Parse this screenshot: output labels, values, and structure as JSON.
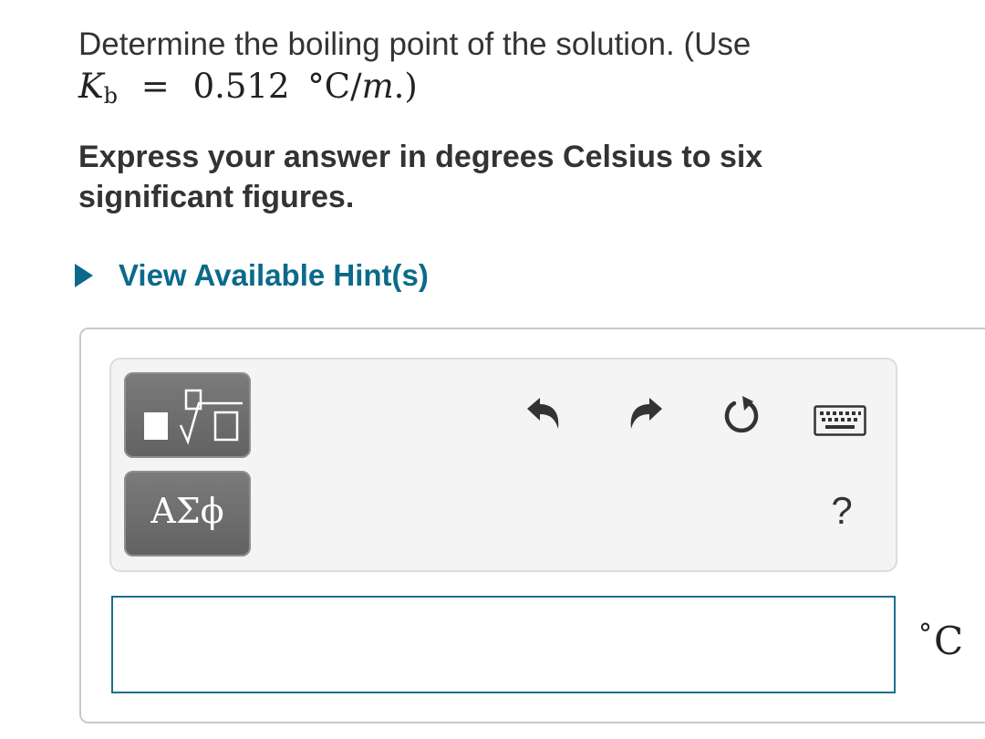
{
  "question": {
    "text": "Determine the boiling point of the solution. (Use",
    "math": {
      "symbol": "K",
      "subscript": "b",
      "equals": "=",
      "value": "0.512",
      "degree": "°",
      "unit_c": "C",
      "slash": "/",
      "unit_m": "m",
      "closing": ".)"
    }
  },
  "instruction": "Express your answer in degrees Celsius to six significant figures.",
  "hints": {
    "label": "View Available Hint(s)"
  },
  "toolbar": {
    "greek_label": "ΑΣϕ",
    "help_label": "?",
    "icons": [
      "templates-icon",
      "undo-icon",
      "redo-icon",
      "reset-icon",
      "keyboard-icon"
    ]
  },
  "answer": {
    "value": "",
    "unit_degree": "°",
    "unit_symbol": "C"
  },
  "colors": {
    "accent": "#0b6a8a",
    "input_border": "#1c6e8c",
    "tool_button": "#6e6e6e"
  }
}
